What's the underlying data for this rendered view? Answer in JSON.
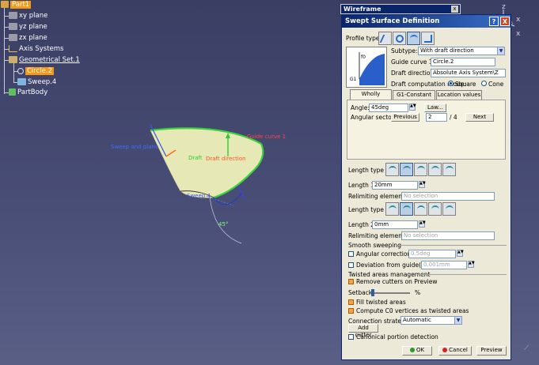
{
  "tree": {
    "root": "Part1",
    "planes": [
      "xy plane",
      "yz plane",
      "zx plane"
    ],
    "axis_systems": "Axis Systems",
    "geo_set": "Geometrical Set.1",
    "circle": "Circle.2",
    "sweep": "Sweep.4",
    "partbody": "PartBody"
  },
  "view": {
    "sweep_and_plane": "Sweep and plane",
    "guide_curve": "Guide curve 1",
    "draft": "Draft",
    "draft_direction": "Draft direction",
    "angle": "45°",
    "sweep_label": "Sweep 4"
  },
  "wireframe": {
    "title": "Wireframe",
    "close": "x"
  },
  "dialog": {
    "title": "Swept Surface Definition",
    "help": "?",
    "close": "X",
    "profile_type": "Profile type:",
    "subtype_label": "Subtype:",
    "subtype_value": "With draft direction",
    "guide_label": "Guide curve 1:",
    "guide_value": "Circle.2",
    "draft_dir_label": "Draft direction:",
    "draft_dir_value": "Absolute Axis System\\Z",
    "draft_mode_label": "Draft computation mode:",
    "square": "Square",
    "cone": "Cone",
    "tabs": [
      "Wholly defined",
      "G1-Constant",
      "Location values"
    ],
    "angle_label": "Angle:",
    "angle_value": "45deg",
    "law": "Law...",
    "angular_sector_label": "Angular sector:",
    "previous": "Previous",
    "sector_value": "2",
    "sector_total": "/ 4",
    "next": "Next",
    "length_type1": "Length type 1:",
    "length1_label": "Length 1:",
    "length1_value": "20mm",
    "relim1_label": "Relimiting element 1:",
    "relim1_value": "No selection",
    "length_type2": "Length type 2:",
    "length2_label": "Length 2:",
    "length2_value": "0mm",
    "relim2_label": "Relimiting element 2:",
    "relim2_value": "No selection",
    "smooth_sweeping": "Smooth sweeping",
    "angular_correction": "Angular correction:",
    "angular_correction_value": "0.5deg",
    "deviation": "Deviation from guide(s):",
    "deviation_value": "0.001mm",
    "twisted": "Twisted areas management",
    "remove_cutters": "Remove cutters on Preview",
    "setback": "Setback",
    "setback_unit": "%",
    "setback_level": 0.02,
    "fill_twisted": "Fill twisted areas",
    "compute_c0": "Compute C0 vertices as twisted areas",
    "connection_label": "Connection strategy:",
    "connection_value": "Automatic",
    "add_cutter": "Add cutter",
    "canonical": "Canonical portion detection",
    "ok": "OK",
    "cancel": "Cancel",
    "preview": "Preview",
    "preview_icon_labels": [
      "f0",
      "G1"
    ]
  },
  "compass_labels": {
    "z": "z",
    "x": "x"
  },
  "colors": {
    "accent": "#f39a16",
    "titlebar": "#0a246a",
    "surface": "#e8e9b8",
    "edge": "#3cd23c"
  }
}
